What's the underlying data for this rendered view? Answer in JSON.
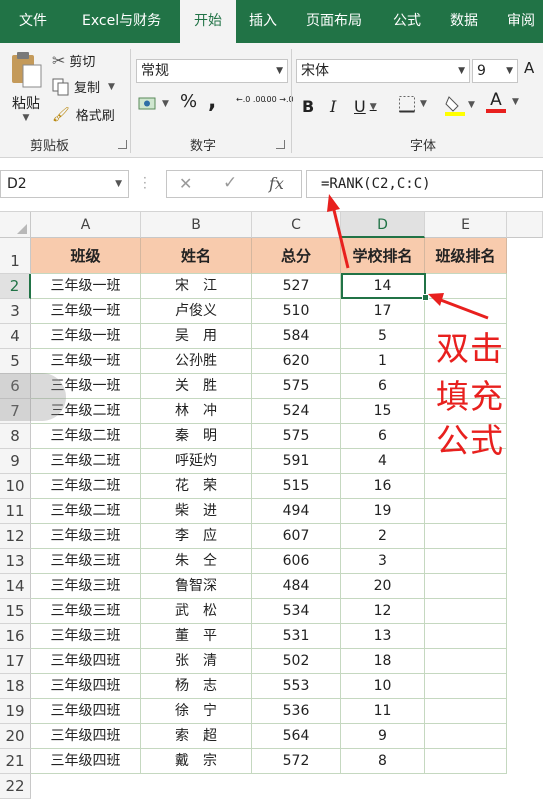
{
  "ribbon_tabs": [
    "文件",
    "Excel与财务",
    "开始",
    "插入",
    "页面布局",
    "公式",
    "数据",
    "审阅"
  ],
  "clipboard": {
    "paste_label": "粘贴",
    "cut_label": "剪切",
    "copy_label": "复制",
    "format_painter_label": "格式刷",
    "group_label": "剪贴板"
  },
  "number": {
    "format_value": "常规",
    "percent_symbol": "%",
    "comma_symbol": ",",
    "increase_decimal": "←.0 .00",
    "decrease_decimal": ".00 →.0",
    "group_label": "数字"
  },
  "font": {
    "name_value": "宋体",
    "size_value": "9",
    "bold": "B",
    "italic": "I",
    "underline": "U",
    "font_color_letter": "A",
    "grow_letter": "A",
    "group_label": "字体",
    "fill_color": "#ffff00",
    "text_color": "#e8201e"
  },
  "formula_bar": {
    "name_box": "D2",
    "fx_symbol": "fx",
    "formula": "=RANK(C2,C:C)"
  },
  "columns": [
    "A",
    "B",
    "C",
    "D",
    "E"
  ],
  "rows": [
    "1",
    "2",
    "3",
    "4",
    "5",
    "6",
    "7",
    "8",
    "9",
    "10",
    "11",
    "12",
    "13",
    "14",
    "15",
    "16",
    "17",
    "18",
    "19",
    "20",
    "21",
    "22"
  ],
  "table": {
    "headers": [
      "班级",
      "姓名",
      "总分",
      "学校排名",
      "班级排名"
    ],
    "records": [
      [
        "三年级一班",
        "宋　江",
        "527",
        "14",
        ""
      ],
      [
        "三年级一班",
        "卢俊义",
        "510",
        "17",
        ""
      ],
      [
        "三年级一班",
        "吴　用",
        "584",
        "5",
        ""
      ],
      [
        "三年级一班",
        "公孙胜",
        "620",
        "1",
        ""
      ],
      [
        "三年级一班",
        "关　胜",
        "575",
        "6",
        ""
      ],
      [
        "三年级二班",
        "林　冲",
        "524",
        "15",
        ""
      ],
      [
        "三年级二班",
        "秦　明",
        "575",
        "6",
        ""
      ],
      [
        "三年级二班",
        "呼延灼",
        "591",
        "4",
        ""
      ],
      [
        "三年级二班",
        "花　荣",
        "515",
        "16",
        ""
      ],
      [
        "三年级二班",
        "柴　进",
        "494",
        "19",
        ""
      ],
      [
        "三年级三班",
        "李　应",
        "607",
        "2",
        ""
      ],
      [
        "三年级三班",
        "朱　仝",
        "606",
        "3",
        ""
      ],
      [
        "三年级三班",
        "鲁智深",
        "484",
        "20",
        ""
      ],
      [
        "三年级三班",
        "武　松",
        "534",
        "12",
        ""
      ],
      [
        "三年级三班",
        "董　平",
        "531",
        "13",
        ""
      ],
      [
        "三年级四班",
        "张　清",
        "502",
        "18",
        ""
      ],
      [
        "三年级四班",
        "杨　志",
        "553",
        "10",
        ""
      ],
      [
        "三年级四班",
        "徐　宁",
        "536",
        "11",
        ""
      ],
      [
        "三年级四班",
        "索　超",
        "564",
        "9",
        ""
      ],
      [
        "三年级四班",
        "戴　宗",
        "572",
        "8",
        ""
      ]
    ]
  },
  "annotation": [
    "双击",
    "填充",
    "公式"
  ],
  "colors": {
    "excel_green": "#217346",
    "header_fill": "#f8cbad",
    "annotation_red": "#e8201e"
  }
}
